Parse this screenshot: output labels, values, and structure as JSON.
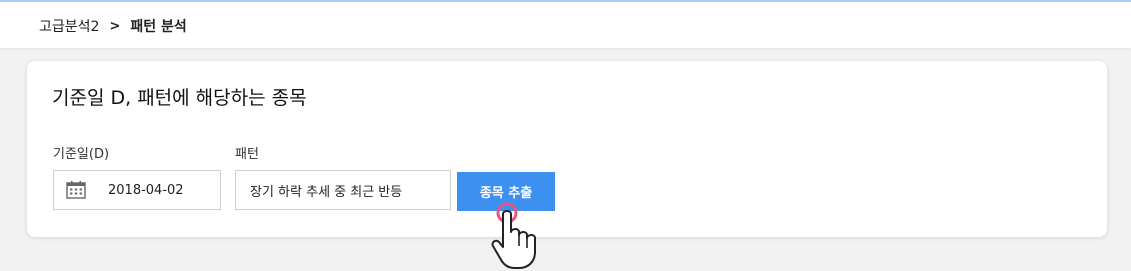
{
  "breadcrumb": {
    "parent": "고급분석2",
    "separator": ">",
    "current": "패턴 분석"
  },
  "card": {
    "title": "기준일 D, 패턴에 해당하는 종목"
  },
  "date_field": {
    "label": "기준일(D)",
    "value": "2018-04-02",
    "icon": "calendar-icon"
  },
  "pattern_field": {
    "label": "패턴",
    "value": "장기 하락 추세 중 최근 반등"
  },
  "extract_button": {
    "label": "종목 추출"
  },
  "colors": {
    "accent": "#3d8ff0",
    "cursor_ring": "#e8567a"
  }
}
